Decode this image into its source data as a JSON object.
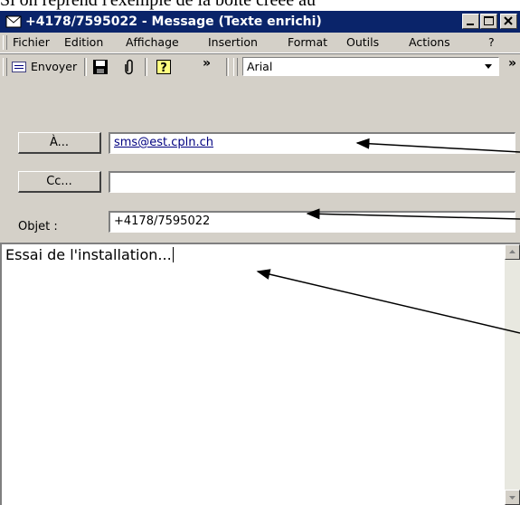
{
  "document": {
    "caption_text": "Si on reprend l'exemple de la boîte créée au"
  },
  "window": {
    "title": "+4178/7595022 - Message (Texte enrichi)"
  },
  "menu": {
    "items": [
      "Fichier",
      "Edition",
      "Affichage",
      "Insertion",
      "Format",
      "Outils",
      "Actions",
      "?"
    ]
  },
  "toolbar": {
    "send_label": "Envoyer",
    "font_name": "Arial",
    "overflow_glyph": "»"
  },
  "header": {
    "to_button": "À...",
    "cc_button": "Cc...",
    "subject_label": "Objet :",
    "to_value": "sms@est.cpln.ch",
    "cc_value": "",
    "subject_value": "+4178/7595022"
  },
  "message": {
    "body_text": "Essai de l'installation..."
  },
  "icons": [
    "envelope-icon",
    "minimize-icon",
    "maximize-icon",
    "close-icon",
    "send-icon",
    "save-icon",
    "paperclip-icon",
    "help-icon",
    "dropdown-arrow-icon"
  ],
  "colors": {
    "titlebar": "#0a246a",
    "window_bg": "#d4d0c8",
    "link": "#000080"
  }
}
